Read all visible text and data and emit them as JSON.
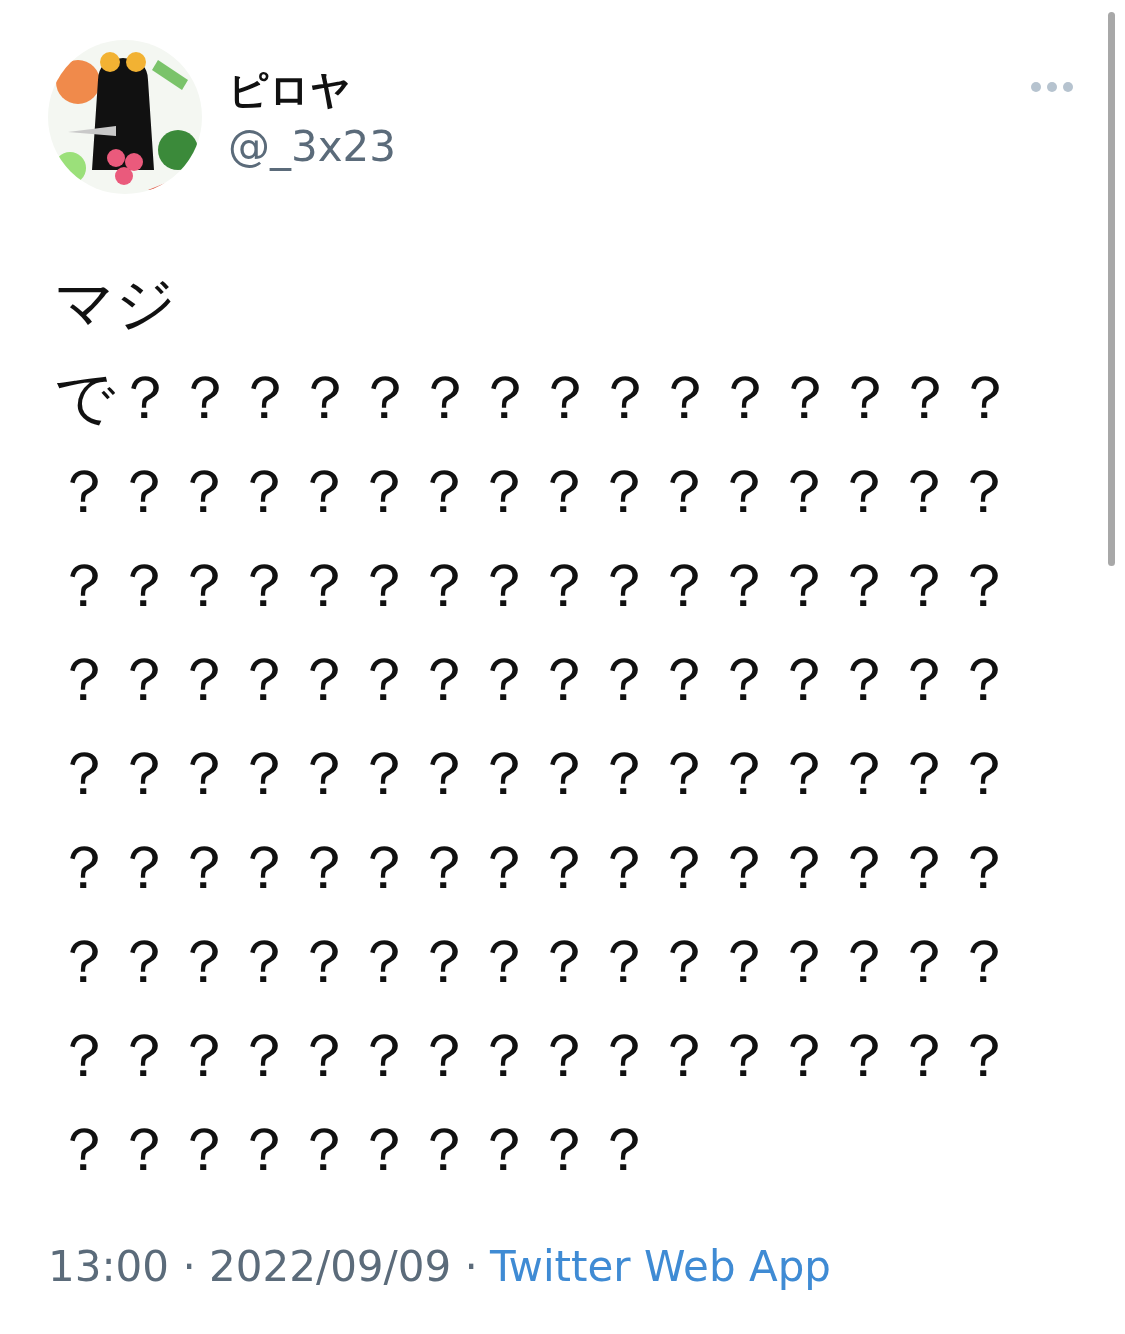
{
  "tweet": {
    "author": {
      "name": "ピロヤ",
      "handle": "@_3x23"
    },
    "body": [
      "マジ",
      "で？？？？？？？？？？？？？？？？？？？？？？？？？？？？？？？？？？？？？？？？？？？？？？？？？？？？？？？？？？？？？？？？？？？？？？？？？？？？？？？？？？？？？？？？？？？？？？？？？？？？？？？？？？？？？？？？？？？？？？？？？？？？？？？？？？？？？？？？？"
    ],
    "meta": "13:00 · 2022/09/09 ·",
    "source": "Twitter Web App"
  }
}
